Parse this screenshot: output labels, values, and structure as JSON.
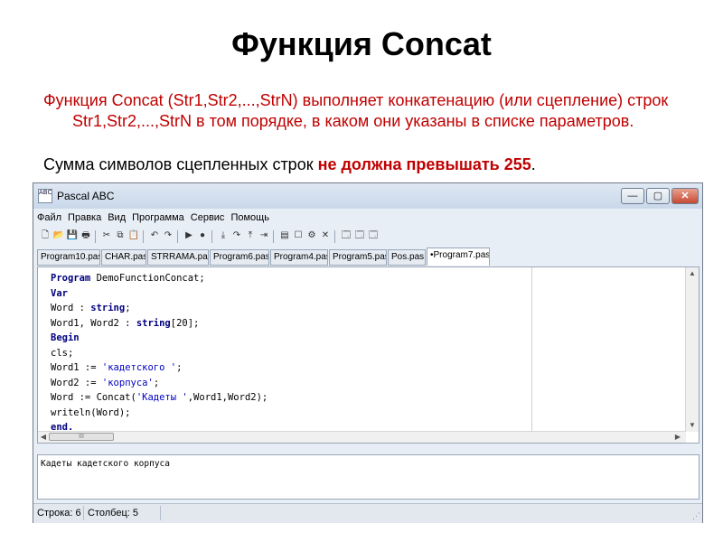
{
  "slide": {
    "title": "Функция Concat",
    "description": "Функция Concat (Str1,Str2,...,StrN) выполняет конкатенацию (или сцепление) строк Str1,Str2,...,StrN в том порядке, в каком они указаны в списке параметров.",
    "note_prefix": "Сумма символов сцепленных строк ",
    "note_highlight": "не должна превышать 255",
    "note_suffix": "."
  },
  "window": {
    "title": "Pascal ABC",
    "icon_label": "ABC",
    "minimize_glyph": "—",
    "maximize_glyph": "▢",
    "close_glyph": "✕"
  },
  "menu": [
    "Файл",
    "Правка",
    "Вид",
    "Программа",
    "Сервис",
    "Помощь"
  ],
  "toolbar": [
    {
      "name": "new-file-icon",
      "glyph": "🗋"
    },
    {
      "name": "open-file-icon",
      "glyph": "📂"
    },
    {
      "name": "save-icon",
      "glyph": "💾"
    },
    {
      "name": "print-icon",
      "glyph": "🖶"
    },
    {
      "name": "cut-icon",
      "glyph": "✂"
    },
    {
      "name": "copy-icon",
      "glyph": "⧉"
    },
    {
      "name": "paste-icon",
      "glyph": "📋"
    },
    {
      "name": "undo-icon",
      "glyph": "↶"
    },
    {
      "name": "redo-icon",
      "glyph": "↷"
    },
    {
      "name": "run-icon",
      "glyph": "▶"
    },
    {
      "name": "stop-icon",
      "glyph": "●"
    },
    {
      "name": "step-into-icon",
      "glyph": "⤓"
    },
    {
      "name": "step-over-icon",
      "glyph": "↷"
    },
    {
      "name": "step-out-icon",
      "glyph": "⤒"
    },
    {
      "name": "run-to-cursor-icon",
      "glyph": "⇥"
    },
    {
      "name": "watch-icon",
      "glyph": "▤"
    },
    {
      "name": "breakpoint-icon",
      "glyph": "☐"
    },
    {
      "name": "debug-icon",
      "glyph": "⚙"
    },
    {
      "name": "clear-icon",
      "glyph": "✕"
    },
    {
      "name": "window-1-icon",
      "glyph": "🗔"
    },
    {
      "name": "window-2-icon",
      "glyph": "🗔"
    },
    {
      "name": "window-3-icon",
      "glyph": "🗔"
    }
  ],
  "tabs": [
    "Program10.pas",
    "CHAR.pas",
    "STRRAMA.pas",
    "Program6.pas",
    "Program4.pas",
    "Program5.pas",
    "Pos.pas",
    "•Program7.pas"
  ],
  "code_lines": [
    [
      {
        "t": "Program",
        "k": true
      },
      {
        "t": " DemoFunctionConcat;"
      }
    ],
    [
      {
        "t": "Var",
        "k": true
      }
    ],
    [
      {
        "t": "Word : "
      },
      {
        "t": "string",
        "k": true
      },
      {
        "t": ";"
      }
    ],
    [
      {
        "t": "Word1, Word2 : "
      },
      {
        "t": "string",
        "k": true
      },
      {
        "t": "[20];"
      }
    ],
    [
      {
        "t": "Begin",
        "k": true
      }
    ],
    [
      {
        "t": "cls;"
      }
    ],
    [
      {
        "t": "Word1 := "
      },
      {
        "t": "'кадетского '",
        "s": true
      },
      {
        "t": ";"
      }
    ],
    [
      {
        "t": "Word2 := "
      },
      {
        "t": "'корпуса'",
        "s": true
      },
      {
        "t": ";"
      }
    ],
    [
      {
        "t": "Word := Concat("
      },
      {
        "t": "'Кадеты '",
        "s": true
      },
      {
        "t": ",Word1,Word2);"
      }
    ],
    [
      {
        "t": "writeln(Word);"
      }
    ],
    [
      {
        "t": "end.",
        "k": true
      }
    ]
  ],
  "scroll": {
    "thumb_glyph": "III",
    "up_glyph": "▲",
    "down_glyph": "▼",
    "left_glyph": "◀",
    "right_glyph": "▶"
  },
  "output_text": "Кадеты кадетского корпуса",
  "status": {
    "line": "Строка: 6",
    "column": "Столбец: 5"
  }
}
